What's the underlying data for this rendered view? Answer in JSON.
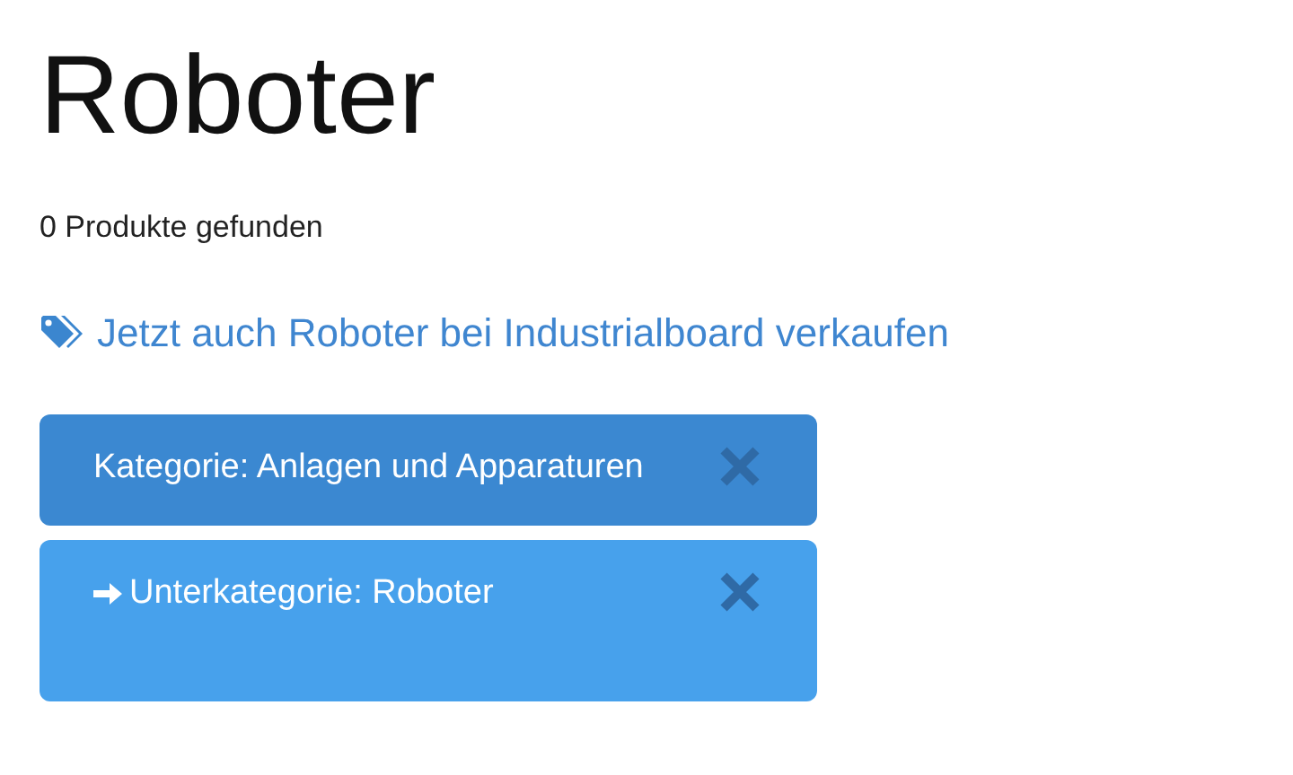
{
  "title": "Roboter",
  "result_count": "0 Produkte gefunden",
  "sell_link": "Jetzt auch Roboter bei Industrialboard verkaufen",
  "filters": [
    {
      "kind": "category",
      "label": "Kategorie: Anlagen und Apparaturen"
    },
    {
      "kind": "subcategory",
      "label": "Unterkategorie: Roboter"
    }
  ]
}
